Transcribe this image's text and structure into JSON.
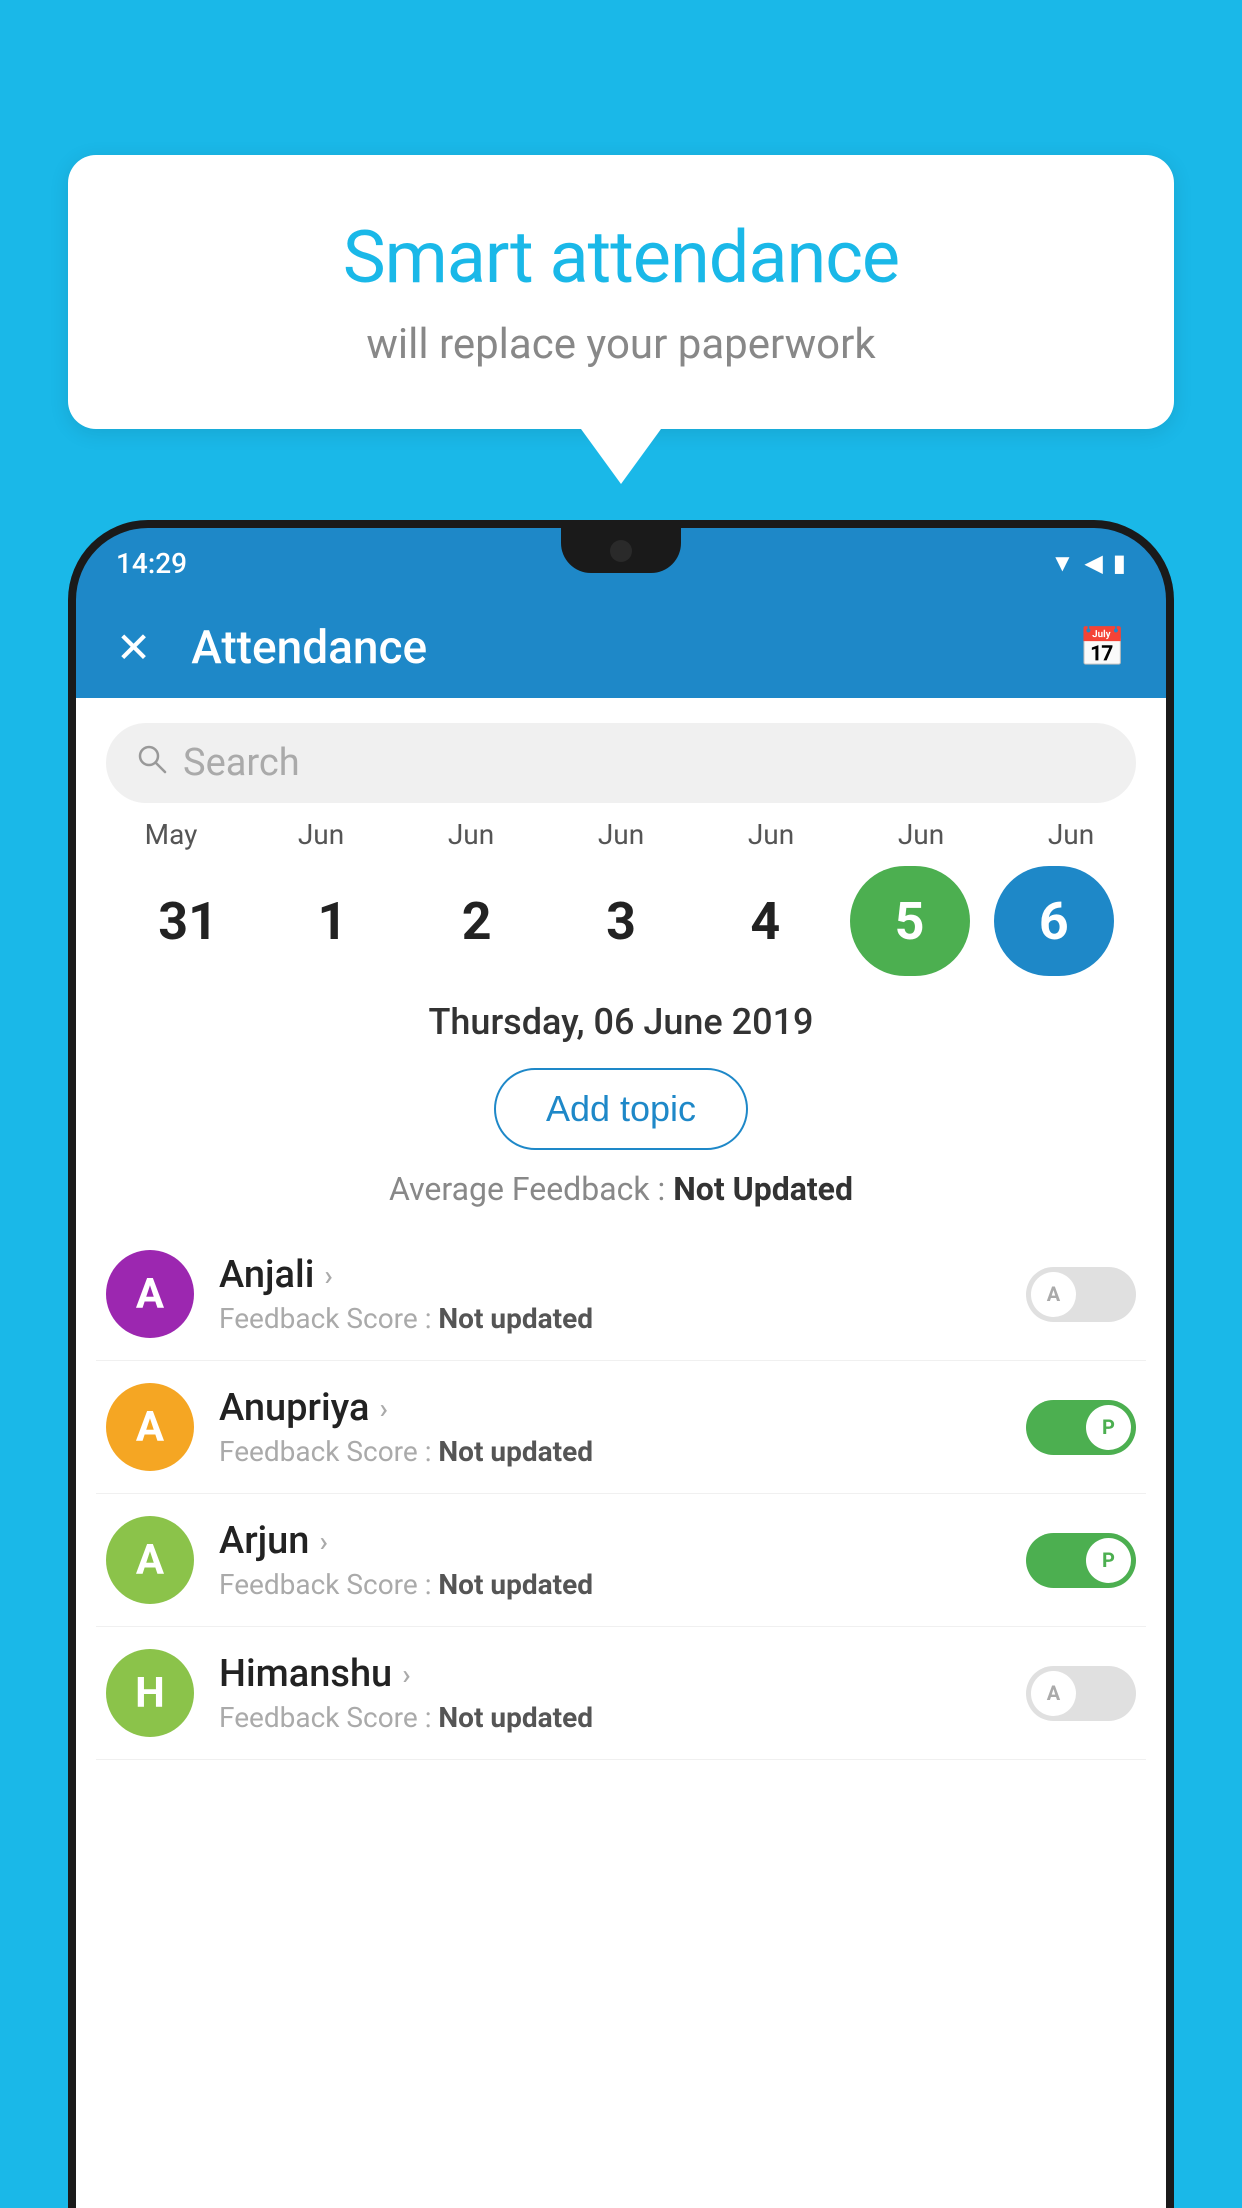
{
  "page": {
    "bg_color": "#1ab8e8"
  },
  "speech_bubble": {
    "title": "Smart attendance",
    "subtitle": "will replace your paperwork"
  },
  "status_bar": {
    "time": "14:29"
  },
  "header": {
    "title": "Attendance",
    "close_label": "✕",
    "calendar_icon": "📅"
  },
  "search": {
    "placeholder": "Search"
  },
  "calendar": {
    "months": [
      "May",
      "Jun",
      "Jun",
      "Jun",
      "Jun",
      "Jun",
      "Jun"
    ],
    "days": [
      "31",
      "1",
      "2",
      "3",
      "4",
      "5",
      "6"
    ],
    "today_index": 5,
    "selected_index": 6
  },
  "selected_date": "Thursday, 06 June 2019",
  "add_topic_label": "Add topic",
  "avg_feedback": {
    "label": "Average Feedback : ",
    "value": "Not Updated"
  },
  "students": [
    {
      "name": "Anjali",
      "avatar_letter": "A",
      "avatar_color": "#9c27b0",
      "feedback_label": "Feedback Score : ",
      "feedback_value": "Not updated",
      "toggle_state": "off",
      "toggle_letter": "A"
    },
    {
      "name": "Anupriya",
      "avatar_letter": "A",
      "avatar_color": "#f5a623",
      "feedback_label": "Feedback Score : ",
      "feedback_value": "Not updated",
      "toggle_state": "on",
      "toggle_letter": "P"
    },
    {
      "name": "Arjun",
      "avatar_letter": "A",
      "avatar_color": "#8bc34a",
      "feedback_label": "Feedback Score : ",
      "feedback_value": "Not updated",
      "toggle_state": "on",
      "toggle_letter": "P"
    },
    {
      "name": "Himanshu",
      "avatar_letter": "H",
      "avatar_color": "#8bc34a",
      "feedback_label": "Feedback Score : ",
      "feedback_value": "Not updated",
      "toggle_state": "off",
      "toggle_letter": "A"
    }
  ]
}
